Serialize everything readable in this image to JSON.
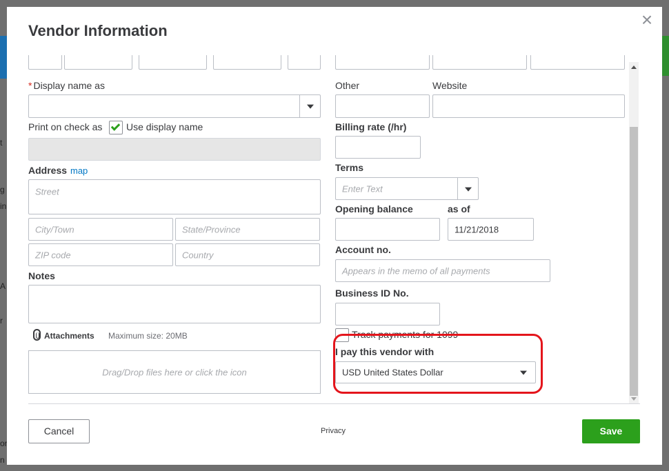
{
  "dialog": {
    "title": "Vendor Information",
    "close_symbol": "×"
  },
  "left": {
    "display_name_label": "Display name as",
    "required_mark": "*",
    "print_on_check_label": "Print on check as",
    "use_display_name_label": "Use display name",
    "use_display_name_checked": true,
    "address_label": "Address",
    "map_link": "map",
    "street_placeholder": "Street",
    "city_placeholder": "City/Town",
    "state_placeholder": "State/Province",
    "zip_placeholder": "ZIP code",
    "country_placeholder": "Country",
    "notes_label": "Notes",
    "attachments_label": "Attachments",
    "max_size_label": "Maximum size: 20MB",
    "dropzone_text": "Drag/Drop files here or click the icon"
  },
  "right": {
    "other_label": "Other",
    "website_label": "Website",
    "billing_rate_label": "Billing rate (/hr)",
    "terms_label": "Terms",
    "terms_placeholder": "Enter Text",
    "opening_balance_label": "Opening balance",
    "as_of_label": "as of",
    "as_of_value": "11/21/2018",
    "account_no_label": "Account no.",
    "account_no_placeholder": "Appears in the memo of all payments",
    "business_id_label": "Business ID No.",
    "track_1099_label": "Track payments for 1099",
    "track_1099_checked": false,
    "currency_label": "I pay this vendor with",
    "currency_value": "USD United States Dollar"
  },
  "footer": {
    "cancel_label": "Cancel",
    "privacy_label": "Privacy",
    "save_label": "Save"
  },
  "colors": {
    "accent_green": "#2ca01c",
    "link_blue": "#0077c5",
    "highlight_red": "#e4151c",
    "required_red": "#d52b1e"
  },
  "background": {
    "letters": [
      "t",
      "g",
      "in",
      "A",
      "r",
      "or",
      "n"
    ]
  }
}
